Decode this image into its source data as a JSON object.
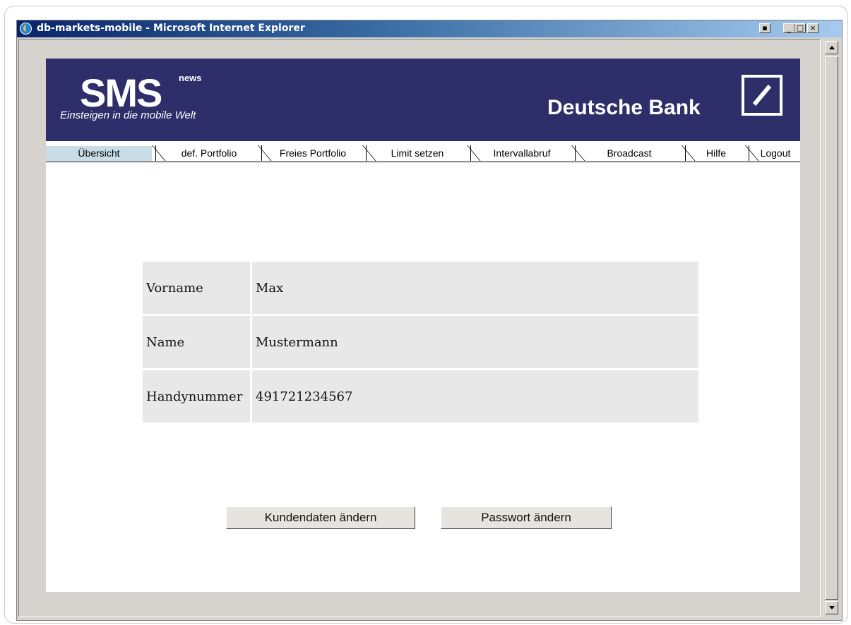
{
  "window": {
    "title": "db-markets-mobile - Microsoft Internet Explorer",
    "controls": {
      "minimize": "_",
      "maximize": "□",
      "close": "×"
    }
  },
  "header": {
    "logo_text": "SMS",
    "logo_superscript": "news",
    "tagline": "Einsteigen in die mobile Welt",
    "bank_name": "Deutsche Bank",
    "colors": {
      "banner": "#2e2e6a",
      "active_tab": "#c8dde6"
    }
  },
  "tabs": [
    {
      "label": "Übersicht",
      "active": true
    },
    {
      "label": "def. Portfolio"
    },
    {
      "label": "Freies Portfolio"
    },
    {
      "label": "Limit setzen"
    },
    {
      "label": "Intervallabruf"
    },
    {
      "label": "Broadcast"
    },
    {
      "label": "Hilfe"
    },
    {
      "label": "Logout"
    }
  ],
  "customer": {
    "rows": [
      {
        "label": "Vorname",
        "value": "Max"
      },
      {
        "label": "Name",
        "value": "Mustermann"
      },
      {
        "label": "Handynummer",
        "value": "491721234567"
      }
    ]
  },
  "actions": {
    "edit_customer": "Kundendaten ändern",
    "change_password": "Passwort ändern"
  }
}
